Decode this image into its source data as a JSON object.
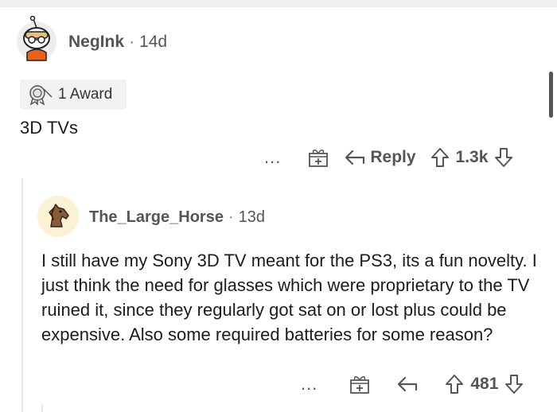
{
  "comment": {
    "author": "NegInk",
    "age": "14d",
    "award_label": "1 Award",
    "body": "3D TVs",
    "more_label": "...",
    "reply_label": "Reply",
    "score": "1.3k"
  },
  "reply": {
    "author": "The_Large_Horse",
    "age": "13d",
    "body": "I still have my Sony 3D TV meant for the PS3, its a fun novelty. I just think the need for glasses which were proprietary to the TV ruined it, since they regularly got sat on or lost plus could be expensive. Also some required batteries for some reason?",
    "more_label": "...",
    "score": "481"
  },
  "colors": {
    "text_primary": "#1c1c1c",
    "text_secondary": "#555555",
    "award_bg": "#f2f2f2",
    "avatar2_bg": "#fbf2d5",
    "avatar1_shirt": "#e8621c"
  },
  "icons": [
    "snoo-avatar-icon",
    "award-icon",
    "more-icon",
    "gift-icon",
    "reply-arrow-icon",
    "upvote-icon",
    "downvote-icon",
    "horse-avatar-icon"
  ]
}
